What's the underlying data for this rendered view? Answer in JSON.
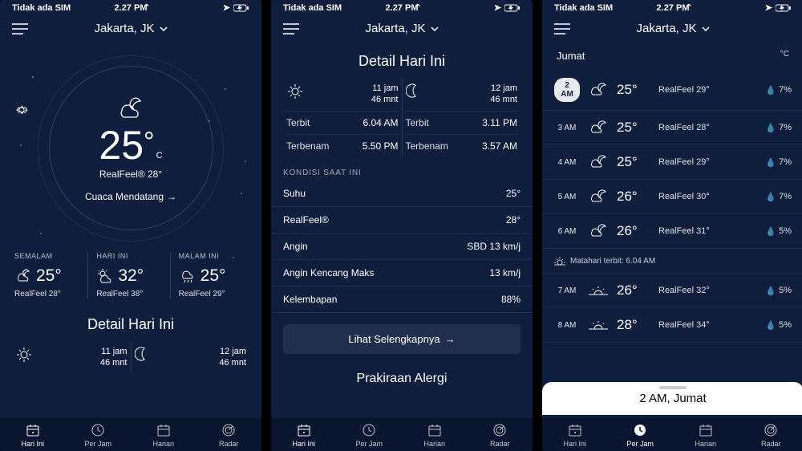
{
  "status": {
    "carrier": "Tidak ada SIM",
    "wifi": "≈",
    "time": "2.27 PM"
  },
  "loc": "Jakarta, JK",
  "s1": {
    "hero": {
      "temp": "25",
      "unit": "C",
      "realfeel": "RealFeel® 28°",
      "forecast": "Cuaca Mendatang"
    },
    "summary": [
      {
        "label": "SEMALAM",
        "temp": "25°",
        "rf": "RealFeel 28°"
      },
      {
        "label": "HARI INI",
        "temp": "32°",
        "rf": "RealFeel 38°"
      },
      {
        "label": "MALAM INI",
        "temp": "25°",
        "rf": "RealFeel 29°"
      }
    ],
    "detail_title": "Detail Hari Ini",
    "sun": {
      "dur1": "11 jam",
      "dur2": "46 mnt"
    },
    "moon": {
      "dur1": "12 jam",
      "dur2": "46 mnt"
    }
  },
  "s2": {
    "title": "Detail Hari Ini",
    "sun": {
      "dur1": "11 jam",
      "dur2": "46 mnt",
      "rise_l": "Terbit",
      "rise_v": "6.04 AM",
      "set_l": "Terbenam",
      "set_v": "5.50 PM"
    },
    "moon": {
      "dur1": "12 jam",
      "dur2": "46 mnt",
      "rise_l": "Terbit",
      "rise_v": "3.11 PM",
      "set_l": "Terbenam",
      "set_v": "3.57 AM"
    },
    "cond_title": "KONDISI SAAT INI",
    "cond": [
      {
        "l": "Suhu",
        "v": "25°"
      },
      {
        "l": "RealFeel®",
        "v": "28°"
      },
      {
        "l": "Angin",
        "v": "SBD 13 km/j"
      },
      {
        "l": "Angin Kencang Maks",
        "v": "13 km/j"
      },
      {
        "l": "Kelembapan",
        "v": "88%"
      }
    ],
    "more": "Lihat Selengkapnya",
    "allergy": "Prakiraan Alergi"
  },
  "s3": {
    "day": "Jumat",
    "unit": "°C",
    "hours": [
      {
        "t": "2 AM",
        "badge": true,
        "temp": "25°",
        "rf": "RealFeel 29°",
        "p": "7%"
      },
      {
        "t": "3 AM",
        "temp": "25°",
        "rf": "RealFeel 28°",
        "p": "7%"
      },
      {
        "t": "4 AM",
        "temp": "25°",
        "rf": "RealFeel 29°",
        "p": "7%"
      },
      {
        "t": "5 AM",
        "temp": "26°",
        "rf": "RealFeel 30°",
        "p": "7%"
      },
      {
        "t": "6 AM",
        "temp": "26°",
        "rf": "RealFeel 31°",
        "p": "5%"
      }
    ],
    "sunrise": "Matahari terbit: 6.04 AM",
    "hours2": [
      {
        "t": "7 AM",
        "temp": "26°",
        "rf": "RealFeel 32°",
        "p": "5%"
      },
      {
        "t": "8 AM",
        "temp": "28°",
        "rf": "RealFeel 34°",
        "p": "5%"
      }
    ],
    "sheet": "2 AM,  Jumat"
  },
  "tabs": [
    "Hari Ini",
    "Per Jam",
    "Harian",
    "Radar"
  ]
}
